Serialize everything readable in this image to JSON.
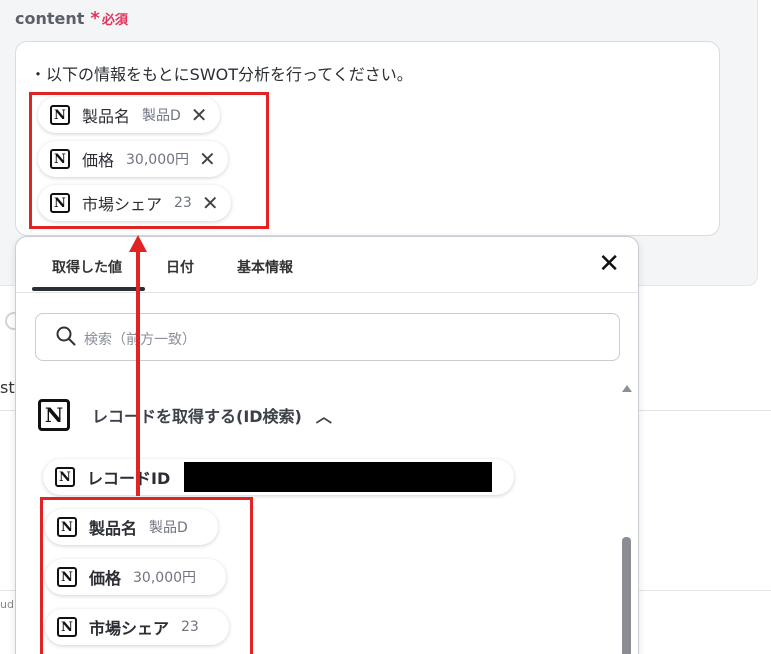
{
  "field": {
    "label": "content",
    "required_star": "*",
    "required_text": "必須",
    "text_line": "・以下の情報をもとにSWOT分析を行ってください。"
  },
  "inserted_chips": [
    {
      "label": "製品名",
      "value": "製品D",
      "remove": "✕"
    },
    {
      "label": "価格",
      "value": "30,000円",
      "remove": "✕"
    },
    {
      "label": "市場シェア",
      "value": "23",
      "remove": "✕"
    }
  ],
  "panel": {
    "tabs": [
      "取得した値",
      "日付",
      "基本情報"
    ],
    "active_tab": "取得した値",
    "close": "✕",
    "search_placeholder": "検索（前方一致）",
    "section": {
      "icon": "notion-icon",
      "title": "レコードを取得する(ID検索)",
      "toggle": "^"
    },
    "items": [
      {
        "label": "レコードID",
        "value": ""
      },
      {
        "label": "製品名",
        "value": "製品D"
      },
      {
        "label": "価格",
        "value": "30,000円"
      },
      {
        "label": "市場シェア",
        "value": "23"
      }
    ]
  },
  "edge": {
    "left_text": "st",
    "left_small": "ud"
  },
  "colors": {
    "highlight": "#e02424",
    "required": "#e0355b"
  }
}
